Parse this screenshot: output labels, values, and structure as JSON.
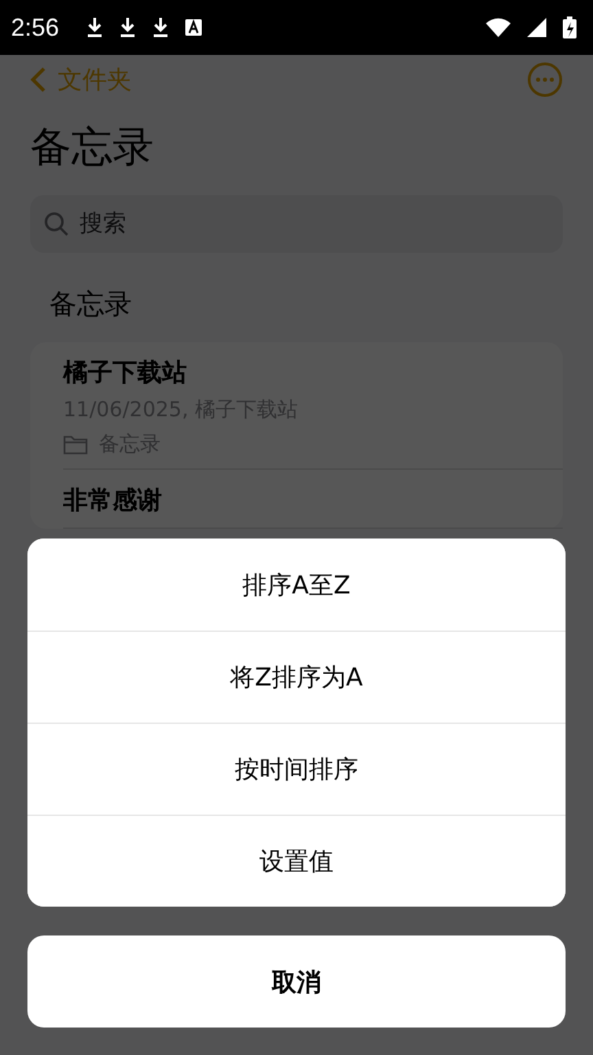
{
  "status_bar": {
    "time": "2:56"
  },
  "nav": {
    "back_label": "文件夹"
  },
  "title": "备忘录",
  "search": {
    "placeholder": "搜索"
  },
  "section_title": "备忘录",
  "notes": [
    {
      "title": "橘子下载站",
      "subtitle": "11/06/2025, 橘子下载站",
      "folder": "备忘录"
    },
    {
      "title": "非常感谢"
    }
  ],
  "action_sheet": {
    "options": [
      "排序A至Z",
      "将Z排序为A",
      "按时间排序",
      "设置值"
    ],
    "cancel": "取消"
  }
}
